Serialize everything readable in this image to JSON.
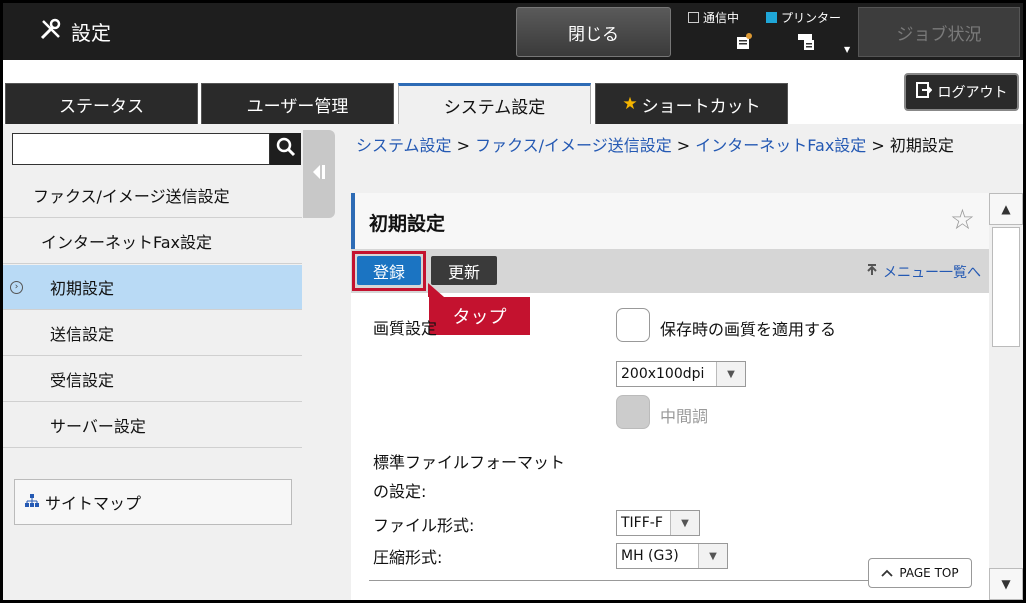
{
  "app": {
    "title": "設定"
  },
  "topbar": {
    "close_label": "閉じる",
    "comm_label": "通信中",
    "printer_label": "プリンター",
    "job_status_label": "ジョブ状況"
  },
  "tabs": [
    {
      "label": "ステータス"
    },
    {
      "label": "ユーザー管理"
    },
    {
      "label": "システム設定"
    },
    {
      "label": "ショートカット"
    }
  ],
  "logout_label": "ログアウト",
  "search": {
    "value": "",
    "placeholder": ""
  },
  "sidebar": {
    "items": [
      {
        "label": "ファクス/イメージ送信設定"
      },
      {
        "label": "インターネットFax設定"
      },
      {
        "label": "初期設定"
      },
      {
        "label": "送信設定"
      },
      {
        "label": "受信設定"
      },
      {
        "label": "サーバー設定"
      }
    ],
    "sitemap_label": "サイトマップ"
  },
  "breadcrumb": {
    "items": [
      "システム設定",
      "ファクス/イメージ送信設定",
      "インターネットFax設定"
    ],
    "sep": " > ",
    "current": "初期設定"
  },
  "panel": {
    "title": "初期設定",
    "register_label": "登録",
    "update_label": "更新",
    "menu_link": "メニュー一覧へ",
    "tap_callout": "タップ"
  },
  "form": {
    "quality_label": "画質設定",
    "apply_quality_label": "保存時の画質を適用する",
    "resolution_value": "200x100dpi",
    "halftone_label": "中間調",
    "std_format_label_1": "標準ファイルフォーマット",
    "std_format_label_2": "の設定:",
    "file_type_label": "ファイル形式:",
    "file_type_value": "TIFF-F",
    "compression_label": "圧縮形式:",
    "compression_value": "MH (G3)"
  },
  "pagetop_label": "PAGE TOP"
}
